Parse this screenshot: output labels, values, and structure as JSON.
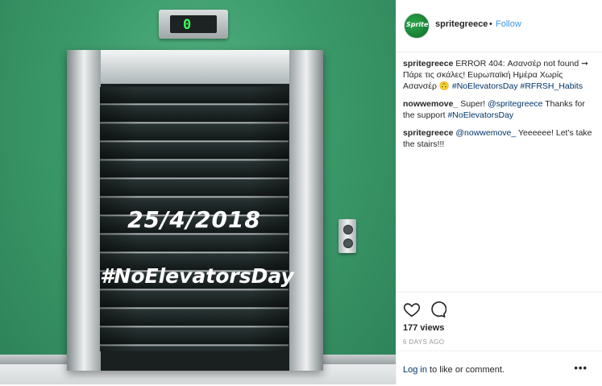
{
  "image": {
    "indicator_display": "0",
    "date_text": "25/4/2018",
    "hashtag_text": "#NoElevatorsDay",
    "avatar_wordmark": "Sprite"
  },
  "header": {
    "username": "spritegreece",
    "separator": "•",
    "follow_label": "Follow"
  },
  "comments": [
    {
      "user": "spritegreece",
      "text": "ERROR 404: Ασανσέρ not found ➞ Πάρε τις σκάλες! Ευρωπαϊκή Ημέρα Χωρίς Ασανσέρ 🙃",
      "tags": "#NoElevatorsDay #RFRSH_Habits"
    },
    {
      "user": "nowwemove_",
      "text_pre": "Super!",
      "mention": "@spritegreece",
      "text_post": "Thanks for the support",
      "tag": "#NoElevatorsDay"
    },
    {
      "user": "spritegreece",
      "mention": "@nowwemove_",
      "text_post": "Yeeeeee! Let's take the stairs!!!"
    }
  ],
  "actions": {
    "like_icon": "heart-icon",
    "comment_icon": "comment-icon",
    "views": "177 views",
    "time_ago": "6 DAYS AGO"
  },
  "footer": {
    "login_link": "Log in",
    "login_rest": "to like or comment.",
    "more_label": "•••"
  },
  "colors": {
    "link": "#003569",
    "follow": "#3897f0",
    "wall_green": "#3b9a69"
  }
}
